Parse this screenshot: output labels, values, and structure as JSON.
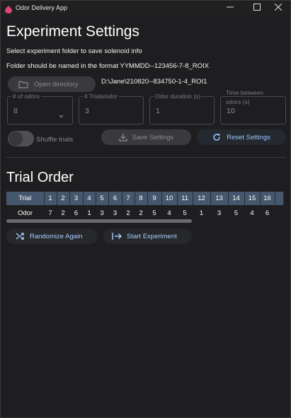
{
  "window": {
    "title": "Odor Delivery App"
  },
  "settings": {
    "heading": "Experiment Settings",
    "info_line1": "Select experiment folder to save solenoid info",
    "info_line2": "Folder should be named in the format YYMMDD--123456-7-8_ROIX",
    "open_directory_label": "Open directory",
    "directory_path": "D:\\Jane\\210820--834750-1-4_ROI1",
    "fields": {
      "num_odors": {
        "label": "# of odors",
        "value": "8"
      },
      "trials_per_odor": {
        "label": "# Trials/odor",
        "value": "3"
      },
      "odor_duration": {
        "label": "Odor duration (s)",
        "value": "1"
      },
      "time_between": {
        "label_line1": "Time between",
        "label_line2": "odors (s)",
        "value": "10"
      }
    },
    "shuffle_label": "Shuffle trials",
    "shuffle_on": false,
    "save_label": "Save Settings",
    "reset_label": "Reset Settings"
  },
  "trial": {
    "heading": "Trial Order",
    "row_header_trial": "Trial",
    "row_header_odor": "Odor",
    "trials": [
      "1",
      "2",
      "3",
      "4",
      "5",
      "6",
      "7",
      "8",
      "9",
      "10",
      "11",
      "12",
      "13",
      "14",
      "15",
      "16"
    ],
    "odors": [
      "7",
      "2",
      "6",
      "1",
      "3",
      "3",
      "2",
      "2",
      "5",
      "4",
      "5",
      "1",
      "3",
      "5",
      "4",
      "6"
    ],
    "randomize_label": "Randomize Again",
    "start_label": "Start Experiment"
  },
  "colors": {
    "accent": "#9bc7ff",
    "table_header": "#45576d",
    "background": "#1e1e20",
    "app_icon": "#e0457b"
  }
}
